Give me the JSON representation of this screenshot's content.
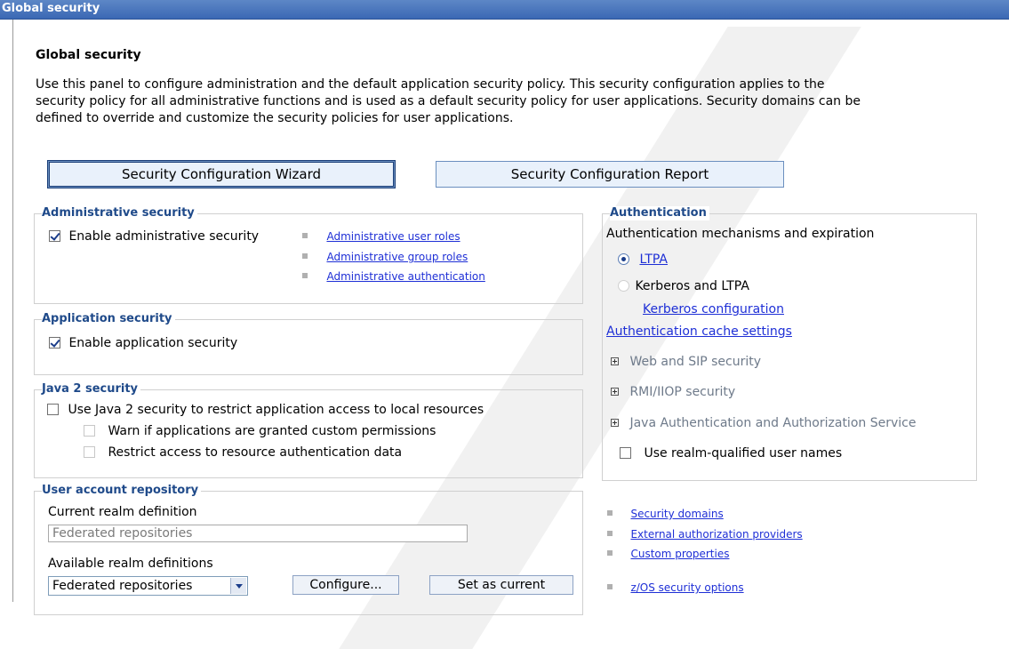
{
  "window": {
    "title": "Global security"
  },
  "page": {
    "title": "Global security",
    "intro_lines": [
      "Use this panel to configure administration and the default application security policy. This security configuration applies to the",
      "security policy for all administrative functions and is used as a default security policy for user applications. Security domains can be",
      "defined to override and customize the security policies for user applications."
    ]
  },
  "buttons": {
    "wizard": "Security Configuration Wizard",
    "report": "Security Configuration Report"
  },
  "admin_security": {
    "legend": "Administrative security",
    "enable_label": "Enable administrative security",
    "enable_checked": true,
    "links": [
      "Administrative user roles",
      "Administrative group roles",
      "Administrative authentication"
    ]
  },
  "app_security": {
    "legend": "Application security",
    "enable_label": "Enable application security",
    "enable_checked": true
  },
  "java2_security": {
    "legend": "Java 2 security",
    "use_label": "Use Java 2 security to restrict application access to local resources",
    "warn_label": "Warn if applications are granted custom permissions",
    "restrict_label": "Restrict access to resource authentication data"
  },
  "user_repo": {
    "legend": "User account repository",
    "current_label": "Current realm definition",
    "current_value": "Federated repositories",
    "available_label": "Available realm definitions",
    "selected": "Federated repositories",
    "configure": "Configure...",
    "set_current": "Set as current"
  },
  "authentication": {
    "legend": "Authentication",
    "mechanisms_label": "Authentication mechanisms and expiration",
    "ltpa": "LTPA",
    "kerberos": "Kerberos and LTPA",
    "kerberos_config": "Kerberos configuration",
    "cache_settings": "Authentication cache settings",
    "web_sip": "Web and SIP security",
    "rmi_iiop": "RMI/IIOP security",
    "jaas": "Java Authentication and Authorization Service",
    "realm_qualified": "Use realm-qualified user names"
  },
  "right_links": [
    "Security domains",
    "External authorization providers",
    "Custom properties",
    "z/OS security options"
  ]
}
